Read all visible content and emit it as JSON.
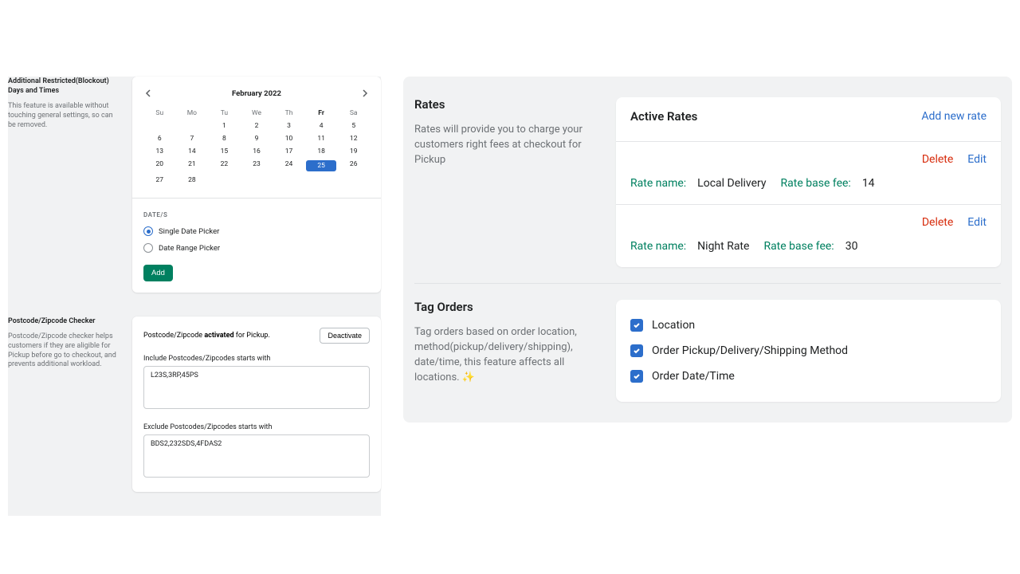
{
  "blockout": {
    "title": "Additional Restricted(Blockout) Days and Times",
    "subtitle": "This feature is available without touching general settings, so can be removed.",
    "month": "February 2022",
    "dow": [
      "Su",
      "Mo",
      "Tu",
      "We",
      "Th",
      "Fr",
      "Sa"
    ],
    "weeks": [
      [
        "",
        "",
        "1",
        "2",
        "3",
        "4",
        "5"
      ],
      [
        "6",
        "7",
        "8",
        "9",
        "10",
        "11",
        "12"
      ],
      [
        "13",
        "14",
        "15",
        "16",
        "17",
        "18",
        "19"
      ],
      [
        "20",
        "21",
        "22",
        "23",
        "24",
        "25",
        "26"
      ],
      [
        "27",
        "28",
        "",
        "",
        "",
        "",
        ""
      ]
    ],
    "selected": "25",
    "bold_dow_index": 5,
    "dates_heading": "DATE/S",
    "radio_single": "Single Date Picker",
    "radio_range": "Date Range Picker",
    "add_label": "Add"
  },
  "postcode": {
    "title": "Postcode/Zipcode Checker",
    "subtitle": "Postcode/Zipcode checker helps customers if they are aligible for Pickup before go to checkout, and prevents additional workload.",
    "status_pre": "Postcode/Zipcode ",
    "status_bold": "activated",
    "status_post": " for Pickup.",
    "deactivate": "Deactivate",
    "include_label": "Include Postcodes/Zipcodes starts with",
    "include_value": "L23S,3RP,45PS",
    "exclude_label": "Exclude Postcodes/Zipcodes starts with",
    "exclude_value": "BDS2,232SDS,4FDAS2"
  },
  "rates": {
    "title": "Rates",
    "subtitle": "Rates will provide you to charge your customers right fees at checkout for Pickup",
    "active_title": "Active Rates",
    "add_new": "Add new rate",
    "delete_label": "Delete",
    "edit_label": "Edit",
    "rate_name_label": "Rate name:",
    "rate_fee_label": "Rate base fee:",
    "items": [
      {
        "name": "Local Delivery",
        "fee": "14"
      },
      {
        "name": "Night Rate",
        "fee": "30"
      }
    ]
  },
  "tags": {
    "title": "Tag Orders",
    "subtitle": "Tag orders based on order location, method(pickup/delivery/shipping), date/time, this feature affects all locations. ✨",
    "options": [
      "Location",
      "Order Pickup/Delivery/Shipping Method",
      "Order Date/Time"
    ]
  }
}
